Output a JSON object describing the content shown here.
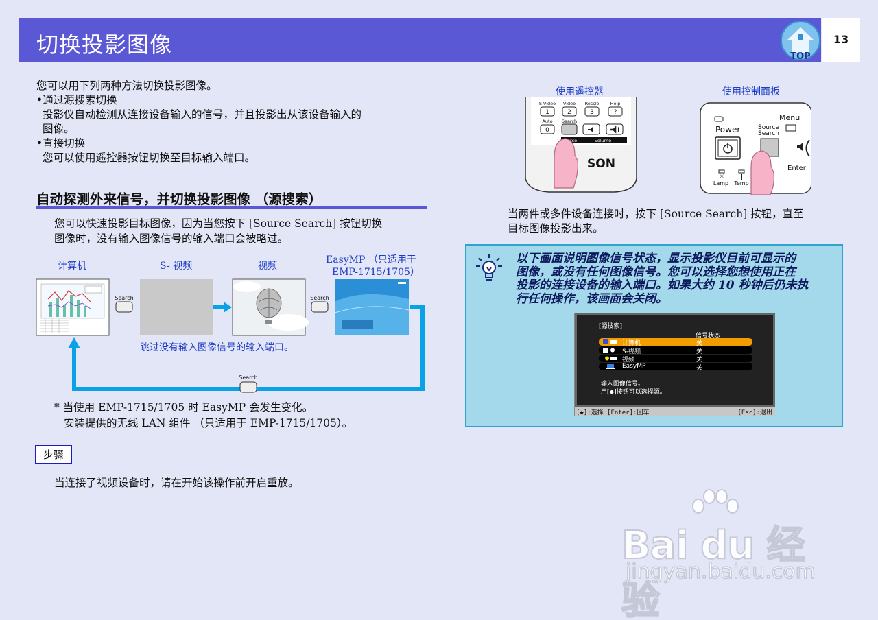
{
  "header": {
    "title": "切换投影图像",
    "page_number": "13",
    "top_label": "TOP"
  },
  "intro": {
    "line1": "您可以用下列两种方法切换投影图像。",
    "bullet1": "•通过源搜索切换",
    "bullet1_desc1": "投影仪自动检测从连接设备输入的信号，并且投影出从该设备输入的",
    "bullet1_desc2": "图像。",
    "bullet2": "•直接切换",
    "bullet2_desc": "您可以使用遥控器按钮切换至目标输入端口。"
  },
  "section": {
    "title": "自动探测外来信号，并切换投影图像 （源搜索）",
    "desc1": "您可以快速投影目标图像，因为当您按下 [Source Search] 按钮切换",
    "desc2": "图像时，没有输入图像信号的输入端口会被略过。"
  },
  "diagram": {
    "label_computer": "计算机",
    "label_svideo": "S- 视频",
    "label_video": "视频",
    "label_easymp1": "EasyMP （只适用于",
    "label_easymp2": "EMP-1715/1705）",
    "search_label": "Search",
    "skip_caption": "跳过没有输入图像信号的输入端口。"
  },
  "note": {
    "line1": "* 当使用 EMP-1715/1705 时 EasyMP 会发生变化。",
    "line2": "安装提供的无线 LAN 组件 （只适用于 EMP-1715/1705）。"
  },
  "step": {
    "badge": "步骤",
    "text": "当连接了视频设备时，请在开始该操作前开启重放。"
  },
  "right": {
    "remote_label": "使用遥控器",
    "panel_label": "使用控制面板",
    "desc1": "当两件或多件设备连接时，按下 [Source Search] 按钮，直至",
    "desc2": "目标图像投影出来。",
    "remote": {
      "keys_top": [
        "S-Video",
        "Video",
        "Resize",
        "Help"
      ],
      "keys_num": [
        "1",
        "2",
        "3",
        "?"
      ],
      "auto": "Auto",
      "zero": "0",
      "search": "Search",
      "source": "Source",
      "volume": "Volume",
      "brand": "SON"
    },
    "panel": {
      "power": "Power",
      "menu": "Menu",
      "source1": "Source",
      "source2": "Search",
      "enter": "Enter",
      "lamp": "Lamp",
      "temp": "Temp"
    }
  },
  "tip": {
    "line1": "以下画面说明图像信号状态，显示投影仪目前可显示的",
    "line2": "图像，或没有任何图像信号。您可以选择您想使用正在",
    "line3": "投影的连接设备的输入端口。如果大约 10 秒钟后仍未执",
    "line4": "行任何操作，该画面会关闭。"
  },
  "osd": {
    "title": "[源搜索]",
    "status_header": "信号状态",
    "rows": [
      {
        "name": "计算机",
        "status": "关"
      },
      {
        "name": "S-视频",
        "status": "关"
      },
      {
        "name": "视频",
        "status": "关"
      },
      {
        "name": "EasyMP",
        "status": "关"
      }
    ],
    "msg1": "·输入图像信号。",
    "msg2": "·用[◆]按钮可以选择源。",
    "footer_left": "[◆]:选择 [Enter]:回车",
    "footer_right": "[Esc]:退出"
  },
  "watermark": {
    "brand": "Bai du 经验",
    "url": "jingyan.baidu.com"
  },
  "colors": {
    "header": "#5b58d6",
    "link_blue": "#1d3cc6",
    "tip_bg": "#a4d9ec",
    "tip_border": "#2ea3cc",
    "flow_blue": "#0aa2e6",
    "osd_select": "#f39c00"
  }
}
